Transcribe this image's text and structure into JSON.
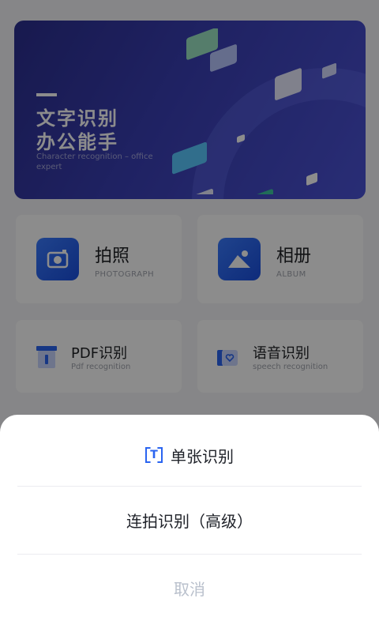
{
  "banner": {
    "title_line1": "文字识别",
    "title_line2": "办公能手",
    "subtitle": "Character recognition – office expert"
  },
  "cards": {
    "photo": {
      "title": "拍照",
      "subtitle": "PHOTOGRAPH",
      "icon": "camera-icon"
    },
    "album": {
      "title": "相册",
      "subtitle": "ALBUM",
      "icon": "image-icon"
    },
    "pdf": {
      "title": "PDF识别",
      "subtitle": "Pdf recognition",
      "icon": "pdf-icon"
    },
    "speech": {
      "title": "语音识别",
      "subtitle": "speech recognition",
      "icon": "voice-icon"
    }
  },
  "sheet": {
    "single": "单张识别",
    "batch": "连拍识别（高级）",
    "cancel": "取消"
  },
  "colors": {
    "accent": "#2a64f0",
    "banner": "#3a3fb5"
  }
}
